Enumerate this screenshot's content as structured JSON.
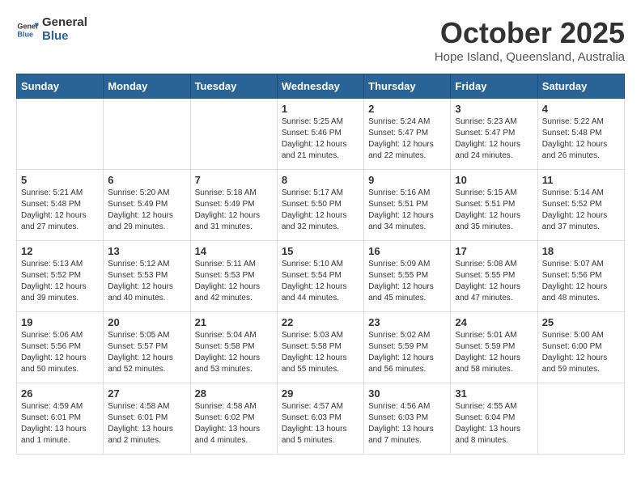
{
  "header": {
    "logo_line1": "General",
    "logo_line2": "Blue",
    "month": "October 2025",
    "location": "Hope Island, Queensland, Australia"
  },
  "weekdays": [
    "Sunday",
    "Monday",
    "Tuesday",
    "Wednesday",
    "Thursday",
    "Friday",
    "Saturday"
  ],
  "weeks": [
    [
      {
        "day": "",
        "text": ""
      },
      {
        "day": "",
        "text": ""
      },
      {
        "day": "",
        "text": ""
      },
      {
        "day": "1",
        "text": "Sunrise: 5:25 AM\nSunset: 5:46 PM\nDaylight: 12 hours\nand 21 minutes."
      },
      {
        "day": "2",
        "text": "Sunrise: 5:24 AM\nSunset: 5:47 PM\nDaylight: 12 hours\nand 22 minutes."
      },
      {
        "day": "3",
        "text": "Sunrise: 5:23 AM\nSunset: 5:47 PM\nDaylight: 12 hours\nand 24 minutes."
      },
      {
        "day": "4",
        "text": "Sunrise: 5:22 AM\nSunset: 5:48 PM\nDaylight: 12 hours\nand 26 minutes."
      }
    ],
    [
      {
        "day": "5",
        "text": "Sunrise: 5:21 AM\nSunset: 5:48 PM\nDaylight: 12 hours\nand 27 minutes."
      },
      {
        "day": "6",
        "text": "Sunrise: 5:20 AM\nSunset: 5:49 PM\nDaylight: 12 hours\nand 29 minutes."
      },
      {
        "day": "7",
        "text": "Sunrise: 5:18 AM\nSunset: 5:49 PM\nDaylight: 12 hours\nand 31 minutes."
      },
      {
        "day": "8",
        "text": "Sunrise: 5:17 AM\nSunset: 5:50 PM\nDaylight: 12 hours\nand 32 minutes."
      },
      {
        "day": "9",
        "text": "Sunrise: 5:16 AM\nSunset: 5:51 PM\nDaylight: 12 hours\nand 34 minutes."
      },
      {
        "day": "10",
        "text": "Sunrise: 5:15 AM\nSunset: 5:51 PM\nDaylight: 12 hours\nand 35 minutes."
      },
      {
        "day": "11",
        "text": "Sunrise: 5:14 AM\nSunset: 5:52 PM\nDaylight: 12 hours\nand 37 minutes."
      }
    ],
    [
      {
        "day": "12",
        "text": "Sunrise: 5:13 AM\nSunset: 5:52 PM\nDaylight: 12 hours\nand 39 minutes."
      },
      {
        "day": "13",
        "text": "Sunrise: 5:12 AM\nSunset: 5:53 PM\nDaylight: 12 hours\nand 40 minutes."
      },
      {
        "day": "14",
        "text": "Sunrise: 5:11 AM\nSunset: 5:53 PM\nDaylight: 12 hours\nand 42 minutes."
      },
      {
        "day": "15",
        "text": "Sunrise: 5:10 AM\nSunset: 5:54 PM\nDaylight: 12 hours\nand 44 minutes."
      },
      {
        "day": "16",
        "text": "Sunrise: 5:09 AM\nSunset: 5:55 PM\nDaylight: 12 hours\nand 45 minutes."
      },
      {
        "day": "17",
        "text": "Sunrise: 5:08 AM\nSunset: 5:55 PM\nDaylight: 12 hours\nand 47 minutes."
      },
      {
        "day": "18",
        "text": "Sunrise: 5:07 AM\nSunset: 5:56 PM\nDaylight: 12 hours\nand 48 minutes."
      }
    ],
    [
      {
        "day": "19",
        "text": "Sunrise: 5:06 AM\nSunset: 5:56 PM\nDaylight: 12 hours\nand 50 minutes."
      },
      {
        "day": "20",
        "text": "Sunrise: 5:05 AM\nSunset: 5:57 PM\nDaylight: 12 hours\nand 52 minutes."
      },
      {
        "day": "21",
        "text": "Sunrise: 5:04 AM\nSunset: 5:58 PM\nDaylight: 12 hours\nand 53 minutes."
      },
      {
        "day": "22",
        "text": "Sunrise: 5:03 AM\nSunset: 5:58 PM\nDaylight: 12 hours\nand 55 minutes."
      },
      {
        "day": "23",
        "text": "Sunrise: 5:02 AM\nSunset: 5:59 PM\nDaylight: 12 hours\nand 56 minutes."
      },
      {
        "day": "24",
        "text": "Sunrise: 5:01 AM\nSunset: 5:59 PM\nDaylight: 12 hours\nand 58 minutes."
      },
      {
        "day": "25",
        "text": "Sunrise: 5:00 AM\nSunset: 6:00 PM\nDaylight: 12 hours\nand 59 minutes."
      }
    ],
    [
      {
        "day": "26",
        "text": "Sunrise: 4:59 AM\nSunset: 6:01 PM\nDaylight: 13 hours\nand 1 minute."
      },
      {
        "day": "27",
        "text": "Sunrise: 4:58 AM\nSunset: 6:01 PM\nDaylight: 13 hours\nand 2 minutes."
      },
      {
        "day": "28",
        "text": "Sunrise: 4:58 AM\nSunset: 6:02 PM\nDaylight: 13 hours\nand 4 minutes."
      },
      {
        "day": "29",
        "text": "Sunrise: 4:57 AM\nSunset: 6:03 PM\nDaylight: 13 hours\nand 5 minutes."
      },
      {
        "day": "30",
        "text": "Sunrise: 4:56 AM\nSunset: 6:03 PM\nDaylight: 13 hours\nand 7 minutes."
      },
      {
        "day": "31",
        "text": "Sunrise: 4:55 AM\nSunset: 6:04 PM\nDaylight: 13 hours\nand 8 minutes."
      },
      {
        "day": "",
        "text": ""
      }
    ]
  ]
}
